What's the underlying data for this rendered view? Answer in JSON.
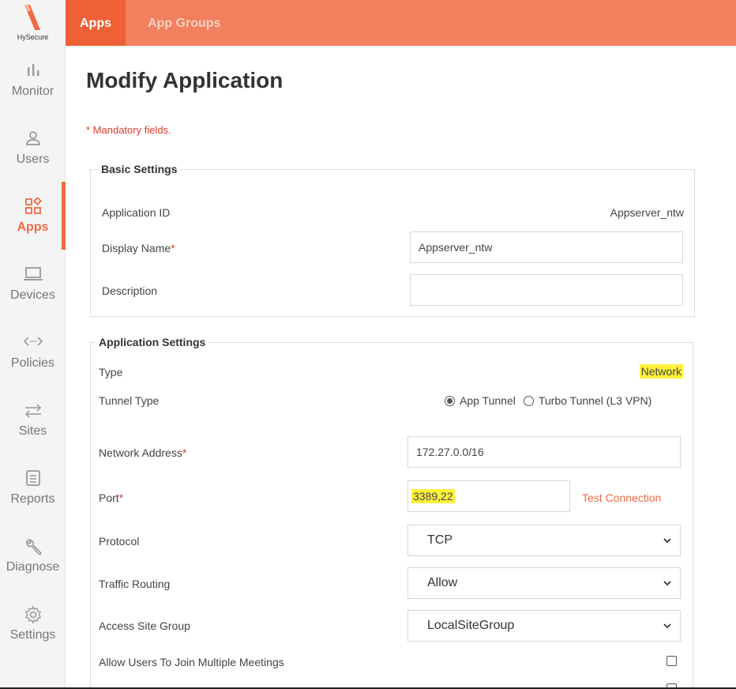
{
  "brand": {
    "name": "HySecure",
    "logo_icon": "hysecure-logo",
    "accent": "#f06a43",
    "topbar": "#f27f5d"
  },
  "sidebar": {
    "items": [
      {
        "label": "Monitor",
        "icon": "bar-chart-icon",
        "active": false
      },
      {
        "label": "Users",
        "icon": "user-icon",
        "active": false
      },
      {
        "label": "Apps",
        "icon": "apps-grid-icon",
        "active": true
      },
      {
        "label": "Devices",
        "icon": "laptop-icon",
        "active": false
      },
      {
        "label": "Policies",
        "icon": "code-arrows-icon",
        "active": false
      },
      {
        "label": "Sites",
        "icon": "swap-arrows-icon",
        "active": false
      },
      {
        "label": "Reports",
        "icon": "report-icon",
        "active": false
      },
      {
        "label": "Diagnose",
        "icon": "wrench-icon",
        "active": false
      },
      {
        "label": "Settings",
        "icon": "gear-icon",
        "active": false
      }
    ]
  },
  "topnav": {
    "tabs": [
      {
        "label": "Apps",
        "active": true
      },
      {
        "label": "App Groups",
        "active": false
      }
    ]
  },
  "page": {
    "title": "Modify Application",
    "mandatory_note": "* Mandatory fields."
  },
  "basic_settings": {
    "legend": "Basic Settings",
    "application_id_label": "Application ID",
    "application_id_value": "Appserver_ntw",
    "display_name_label": "Display Name",
    "display_name_value": "Appserver_ntw",
    "description_label": "Description",
    "description_value": ""
  },
  "application_settings": {
    "legend": "Application Settings",
    "type_label": "Type",
    "type_value": "Network",
    "tunnel_type_label": "Tunnel Type",
    "tunnel_options": [
      {
        "label": "App Tunnel",
        "selected": true
      },
      {
        "label": "Turbo Tunnel (L3 VPN)",
        "selected": false
      }
    ],
    "network_address_label": "Network Address",
    "network_address_value": "172.27.0.0/16",
    "port_label": "Port",
    "port_value": "3389,22",
    "test_connection_label": "Test Connection",
    "protocol_label": "Protocol",
    "protocol_value": "TCP",
    "traffic_routing_label": "Traffic Routing",
    "traffic_routing_value": "Allow",
    "access_site_group_label": "Access Site Group",
    "access_site_group_value": "LocalSiteGroup",
    "allow_multiple_meetings_label": "Allow Users To Join Multiple Meetings",
    "allow_multiple_meetings_checked": false
  },
  "required_mark": "*"
}
